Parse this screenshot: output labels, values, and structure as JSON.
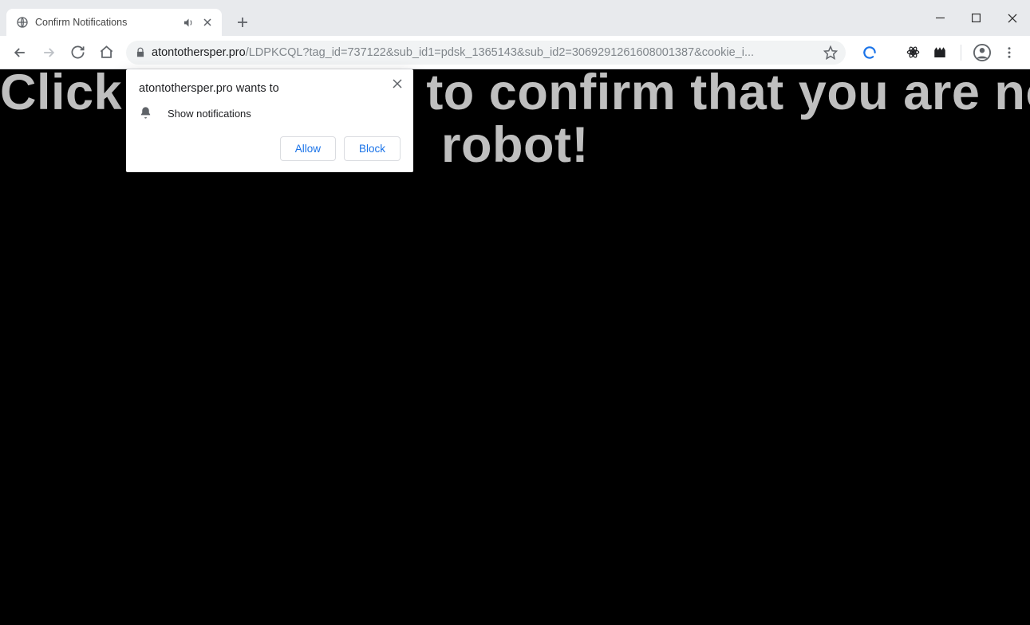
{
  "window_controls": {
    "minimize": "minimize",
    "maximize": "maximize",
    "close": "close"
  },
  "tab": {
    "title": "Confirm Notifications",
    "muted": true
  },
  "address_bar": {
    "host": "atontothersper.pro",
    "path": "/LDPKCQL?tag_id=737122&sub_id1=pdsk_1365143&sub_id2=3069291261608001387&cookie_i..."
  },
  "page": {
    "line1": "Click the \"Allow\" to confirm that you are not a",
    "line2": "robot!"
  },
  "notification_popup": {
    "title": "atontothersper.pro wants to",
    "body": "Show notifications",
    "allow": "Allow",
    "block": "Block"
  }
}
